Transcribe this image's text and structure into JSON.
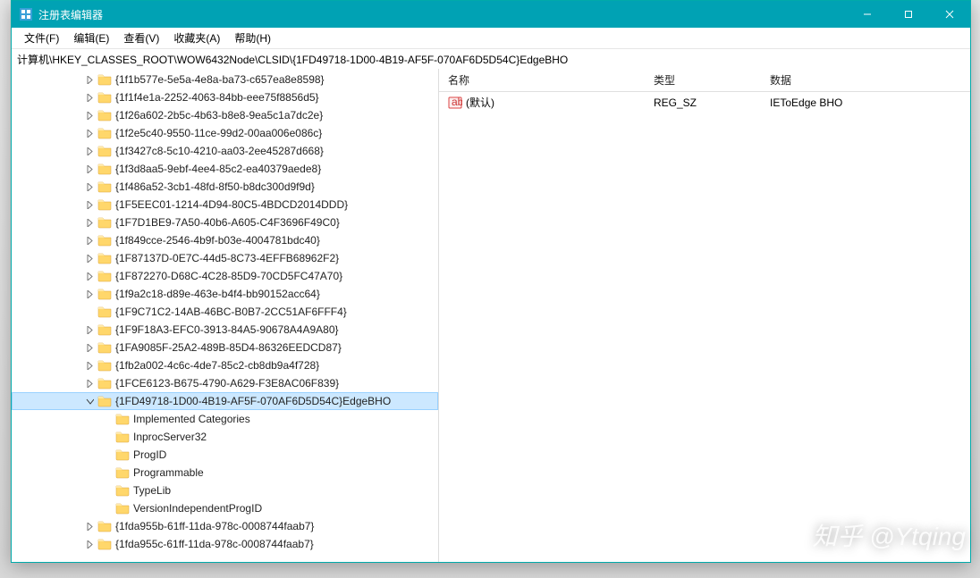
{
  "window": {
    "title": "注册表编辑器",
    "minimize": "–",
    "maximize": "☐",
    "close": "✕"
  },
  "menu": {
    "file": "文件(F)",
    "edit": "编辑(E)",
    "view": "查看(V)",
    "favorites": "收藏夹(A)",
    "help": "帮助(H)"
  },
  "address": "计算机\\HKEY_CLASSES_ROOT\\WOW6432Node\\CLSID\\{1FD49718-1D00-4B19-AF5F-070AF6D5D54C}EdgeBHO",
  "tree": {
    "items": [
      {
        "label": "{1f1b577e-5e5a-4e8a-ba73-c657ea8e8598}",
        "exp": "closed"
      },
      {
        "label": "{1f1f4e1a-2252-4063-84bb-eee75f8856d5}",
        "exp": "closed"
      },
      {
        "label": "{1f26a602-2b5c-4b63-b8e8-9ea5c1a7dc2e}",
        "exp": "closed"
      },
      {
        "label": "{1f2e5c40-9550-11ce-99d2-00aa006e086c}",
        "exp": "closed"
      },
      {
        "label": "{1f3427c8-5c10-4210-aa03-2ee45287d668}",
        "exp": "closed"
      },
      {
        "label": "{1f3d8aa5-9ebf-4ee4-85c2-ea40379aede8}",
        "exp": "closed"
      },
      {
        "label": "{1f486a52-3cb1-48fd-8f50-b8dc300d9f9d}",
        "exp": "closed"
      },
      {
        "label": "{1F5EEC01-1214-4D94-80C5-4BDCD2014DDD}",
        "exp": "closed"
      },
      {
        "label": "{1F7D1BE9-7A50-40b6-A605-C4F3696F49C0}",
        "exp": "closed"
      },
      {
        "label": "{1f849cce-2546-4b9f-b03e-4004781bdc40}",
        "exp": "closed"
      },
      {
        "label": "{1F87137D-0E7C-44d5-8C73-4EFFB68962F2}",
        "exp": "closed"
      },
      {
        "label": "{1F872270-D68C-4C28-85D9-70CD5FC47A70}",
        "exp": "closed"
      },
      {
        "label": "{1f9a2c18-d89e-463e-b4f4-bb90152acc64}",
        "exp": "closed"
      },
      {
        "label": "{1F9C71C2-14AB-46BC-B0B7-2CC51AF6FFF4}",
        "exp": "none"
      },
      {
        "label": "{1F9F18A3-EFC0-3913-84A5-90678A4A9A80}",
        "exp": "closed"
      },
      {
        "label": "{1FA9085F-25A2-489B-85D4-86326EEDCD87}",
        "exp": "closed"
      },
      {
        "label": "{1fb2a002-4c6c-4de7-85c2-cb8db9a4f728}",
        "exp": "closed"
      },
      {
        "label": "{1FCE6123-B675-4790-A629-F3E8AC06F839}",
        "exp": "closed"
      },
      {
        "label": "{1FD49718-1D00-4B19-AF5F-070AF6D5D54C}EdgeBHO",
        "exp": "open",
        "selected": true
      },
      {
        "label": "Implemented Categories",
        "exp": "closed",
        "child": true
      },
      {
        "label": "InprocServer32",
        "exp": "none",
        "child": true
      },
      {
        "label": "ProgID",
        "exp": "none",
        "child": true
      },
      {
        "label": "Programmable",
        "exp": "none",
        "child": true
      },
      {
        "label": "TypeLib",
        "exp": "none",
        "child": true
      },
      {
        "label": "VersionIndependentProgID",
        "exp": "none",
        "child": true
      },
      {
        "label": "{1fda955b-61ff-11da-978c-0008744faab7}",
        "exp": "closed"
      },
      {
        "label": "{1fda955c-61ff-11da-978c-0008744faab7}",
        "exp": "closed"
      }
    ]
  },
  "list": {
    "columns": {
      "name": "名称",
      "type": "类型",
      "data": "数据"
    },
    "rows": [
      {
        "name": "(默认)",
        "type": "REG_SZ",
        "data": "IEToEdge BHO"
      }
    ]
  },
  "watermark": "知乎 @Ytqing"
}
